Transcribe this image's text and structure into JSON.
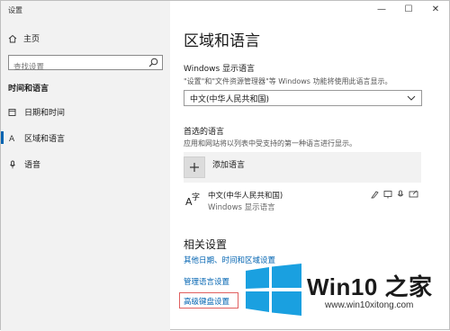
{
  "app": {
    "title": "设置"
  },
  "window_controls": {
    "minimize": "—",
    "maximize": "☐",
    "close": "✕"
  },
  "sidebar": {
    "home": "主页",
    "search_placeholder": "查找设置",
    "section": "时间和语言",
    "items": [
      {
        "label": "日期和时间",
        "icon": "calendar-clock-icon"
      },
      {
        "label": "区域和语言",
        "icon": "region-language-icon",
        "active": true
      },
      {
        "label": "语音",
        "icon": "microphone-icon"
      }
    ]
  },
  "main": {
    "title": "区域和语言",
    "windows_display_language": {
      "label": "Windows 显示语言",
      "desc": "\"设置\"和\"文件资源管理器\"等 Windows 功能将使用此语言显示。",
      "selected": "中文(中华人民共和国)"
    },
    "preferred_languages": {
      "label": "首选的语言",
      "desc": "应用和网站将以列表中受支持的第一种语言进行显示。",
      "add_label": "添加语言",
      "languages": [
        {
          "name": "中文(中华人民共和国)",
          "sub": "Windows 显示语言"
        }
      ]
    },
    "related": {
      "title": "相关设置",
      "links": [
        "其他日期、时间和区域设置",
        "管理语言设置",
        "高级键盘设置"
      ]
    }
  },
  "watermark": {
    "brand": "Win10 之家",
    "url": "www.win10xitong.com"
  },
  "colors": {
    "accent": "#0063b1",
    "sidebar_bg": "#f2f2f2",
    "highlight": "#e06060",
    "logo_blue": "#1aa0e0"
  }
}
